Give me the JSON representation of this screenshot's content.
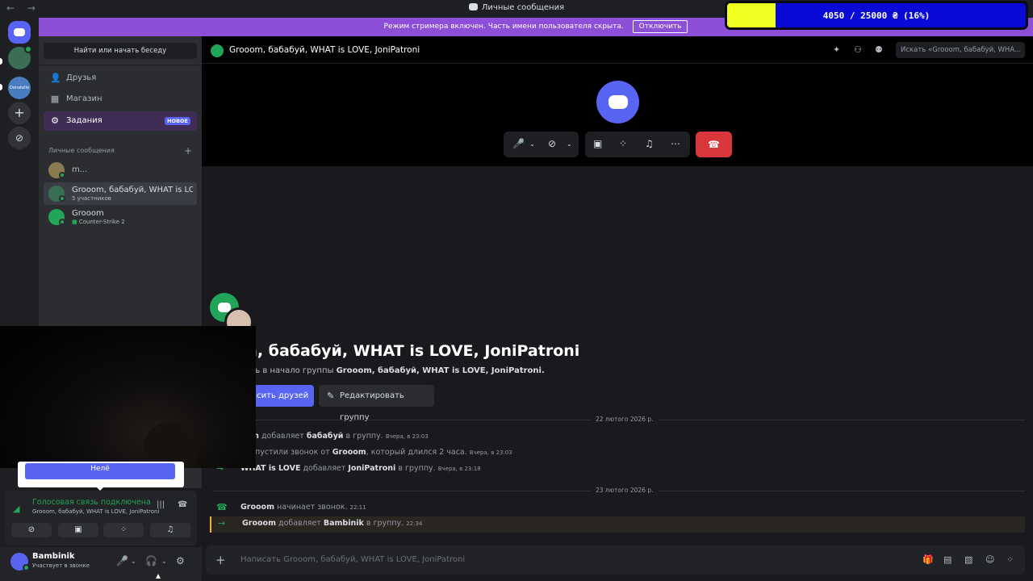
{
  "titlebar": {
    "nav": "← →",
    "title": "Личные сообщения"
  },
  "streamer_bar": {
    "text": "Режим стримера включен. Часть имени пользователя скрыта.",
    "button": "Отключить",
    "color": "#8e4fd8"
  },
  "overlay_progress": {
    "text": "4050 / 25000 ₴ (16%)",
    "current": 4050,
    "goal": 25000,
    "percent": 16,
    "fill_color": "#f0ff20",
    "bg_color": "#0a0ad6"
  },
  "servers": [
    {
      "name": "home-icon"
    },
    {
      "name": "server-2"
    },
    {
      "name": "server-donatello",
      "label": "Donatello"
    },
    {
      "name": "add-server",
      "label": "+"
    },
    {
      "name": "explore",
      "label": "⊘"
    }
  ],
  "sidebar": {
    "search_label": "Найти или начать беседу",
    "nav": [
      {
        "label": "Друзья",
        "icon": "friends-icon",
        "glyph": "👤"
      },
      {
        "label": "Магазин",
        "icon": "shop-icon",
        "glyph": "▦"
      },
      {
        "label": "Задания",
        "icon": "quests-icon",
        "glyph": "⚙",
        "badge": "НОВОЕ"
      }
    ],
    "dm_header": "Личные сообщения",
    "dm_add": "+",
    "dms": [
      {
        "name": "m...",
        "sub": ""
      },
      {
        "name": "Grooom, бабабуй, WHAT is LOVE, JoniPatroni",
        "sub": "5 участников"
      },
      {
        "name": "Grooom",
        "sub": "Counter-Strike 2"
      }
    ]
  },
  "tooltip": {
    "label": "Нелё"
  },
  "voice_panel": {
    "status": "Голосовая связь подключена",
    "channel": "Grooom, бабабуй, WHAT is LOVE, JoniPatroni",
    "buttons": [
      "camera-off",
      "screen-share",
      "activities",
      "soundboard"
    ]
  },
  "user": {
    "name": "Bambinik",
    "status": "Участвует в звонке"
  },
  "chat": {
    "header_name": "Grooom, бабабуй, WHAT is LOVE, JoniPatroni",
    "search_placeholder": "Искать «Grooom, бабабуй, WHA...",
    "welcome_title": "om, бабабуй, WHAT is LOVE, JoniPatroni",
    "welcome_sub_prefix": "ловать в начало группы",
    "welcome_sub_name": "Grooom, бабабуй, WHAT is LOVE, JoniPatroni.",
    "invite_button": "асить друзей",
    "edit_button": "Редактировать группу",
    "dates": [
      "22 лютого 2026 р.",
      "23 лютого 2026 р."
    ],
    "messages": [
      {
        "actor": "oom",
        "action": "добавляет",
        "target": "бабабуй",
        "suffix": "в группу.",
        "time": "Вчера, в 23:03"
      },
      {
        "actor": "",
        "action": "пропустили звонок от",
        "target": "Grooom",
        "suffix": ", который длился 2 часа.",
        "time": "Вчера, в 23:03"
      },
      {
        "actor": "WHAT is LOVE",
        "action": "добавляет",
        "target": "JoniPatroni",
        "suffix": "в группу.",
        "time": "Вчера, в 23:18"
      },
      {
        "actor": "Grooom",
        "action": "начинает звонок.",
        "target": "",
        "suffix": "",
        "time": "22:11"
      },
      {
        "actor": "Grooom",
        "action": "добавляет",
        "target": "Bambinik",
        "suffix": "в группу.",
        "time": "22:34"
      }
    ],
    "composer_placeholder": "Написать Grooom, бабабуй, WHAT is LOVE, JoniPatroni"
  }
}
